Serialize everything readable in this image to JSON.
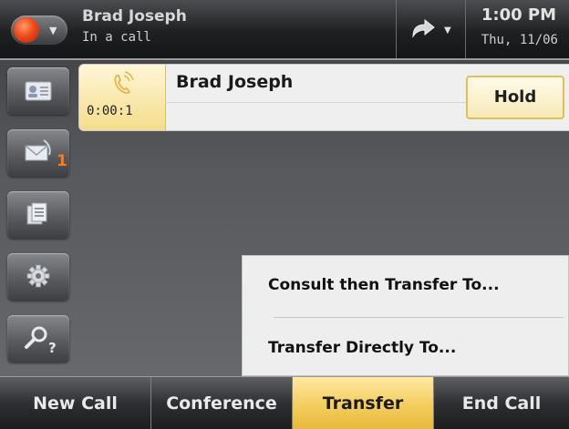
{
  "header": {
    "caller_name": "Brad Joseph",
    "call_status": "In a call",
    "time": "1:00 PM",
    "date": "Thu, 11/06",
    "status_color": "#ee4a1a"
  },
  "sidebar": {
    "items": [
      {
        "icon": "contacts-icon"
      },
      {
        "icon": "messages-icon",
        "badge": "1"
      },
      {
        "icon": "call-log-icon"
      },
      {
        "icon": "gear-icon"
      },
      {
        "icon": "help-search-icon"
      }
    ]
  },
  "call": {
    "name": "Brad Joseph",
    "timer": "0:00:1",
    "hold_label": "Hold"
  },
  "transfer_menu": {
    "items": [
      "Consult then Transfer To...",
      "Transfer Directly To..."
    ]
  },
  "softkeys": [
    {
      "label": "New Call"
    },
    {
      "label": "Conference"
    },
    {
      "label": "Transfer",
      "active": true
    },
    {
      "label": "End Call"
    }
  ],
  "colors": {
    "accent": "#f3cd5c",
    "badge": "#ff7a1a"
  }
}
